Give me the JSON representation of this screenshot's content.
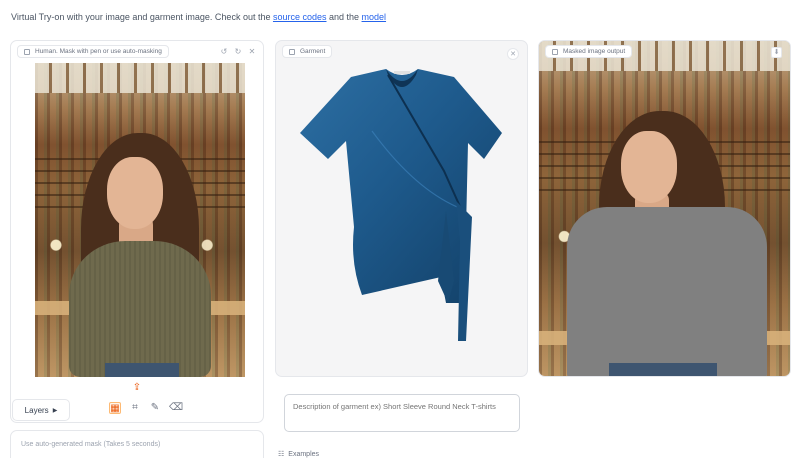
{
  "intro": {
    "text_before": "Virtual Try-on with your image and garment image. Check out the ",
    "link1": "source codes",
    "text_middle": " and the ",
    "link2": "model"
  },
  "human_panel": {
    "label": "Human. Mask with pen or use auto-masking",
    "layers_label": "Layers",
    "auto_mask_label": "Use auto-generated mask (Takes 5 seconds)"
  },
  "garment_panel": {
    "label": "Garment",
    "description_placeholder": "Description of garment ex) Short Sleeve Round Neck T-shirts",
    "examples_label": "Examples"
  },
  "output_panel": {
    "label": "Masked image output"
  },
  "colors": {
    "link": "#2563eb",
    "active_tool": "#ea580c",
    "garment": "#1f5a8a",
    "mask": "#808080"
  },
  "icons": [
    "upload-icon",
    "brush-icon",
    "crop-icon",
    "pen-icon",
    "eraser-icon",
    "download-icon",
    "close-icon",
    "undo-icon",
    "redo-icon"
  ]
}
